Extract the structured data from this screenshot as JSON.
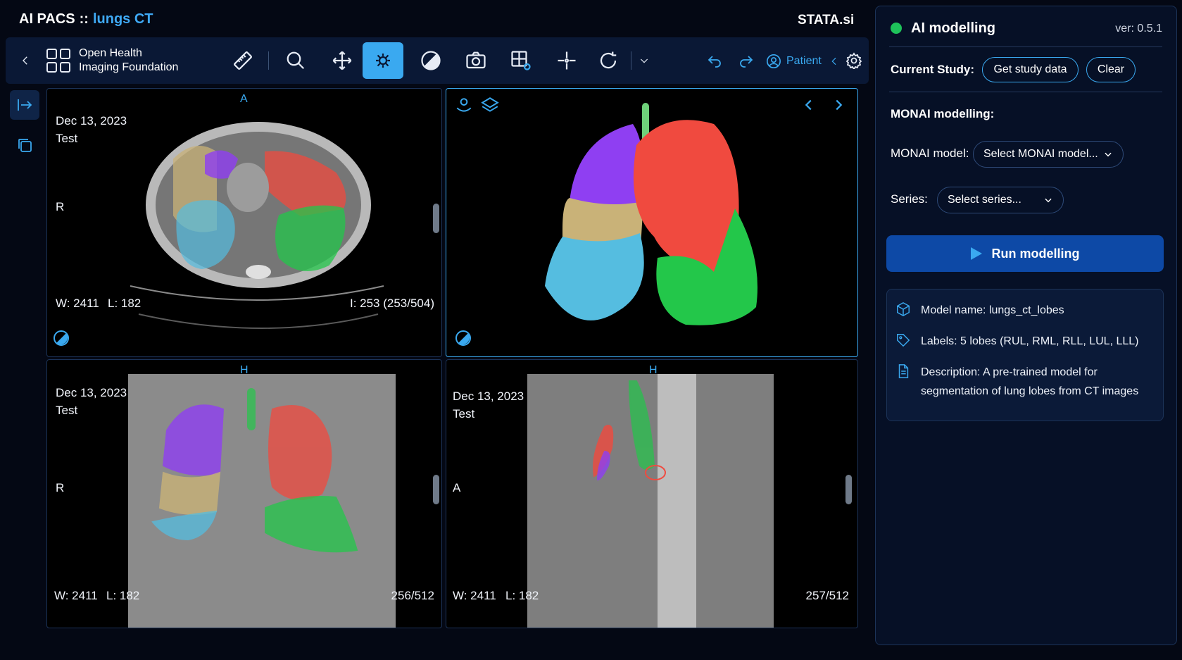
{
  "header": {
    "app_name": "AI PACS",
    "separator": "::",
    "study_name": "lungs CT",
    "brand": "STATA.si"
  },
  "toolbar": {
    "logo_line1": "Open Health",
    "logo_line2": "Imaging Foundation",
    "tools": [
      "back-chevron-icon",
      "ruler-icon",
      "magnify-icon",
      "pan-icon",
      "segmentation-icon",
      "contrast-icon",
      "camera-icon",
      "layout-icon",
      "crosshair-icon",
      "rotate-icon",
      "more-chevron-icon",
      "undo-icon",
      "redo-icon",
      "settings-icon"
    ],
    "patient_label": "Patient",
    "active_tool": "segmentation-icon",
    "accent": "#3aa9f0"
  },
  "viewports": {
    "axial": {
      "orientation_top": "A",
      "date": "Dec 13, 2023",
      "desc": "Test",
      "orientation_left": "R",
      "window": "W: 2411",
      "level": "L: 182",
      "instance": "I: 253 (253/504)"
    },
    "volume": {},
    "coronal": {
      "orientation_top": "H",
      "date": "Dec 13, 2023",
      "desc": "Test",
      "orientation_left": "R",
      "window": "W: 2411",
      "level": "L: 182",
      "instance": "256/512"
    },
    "sagittal": {
      "orientation_top": "H",
      "date": "Dec 13, 2023",
      "desc": "Test",
      "orientation_left": "A",
      "window": "W: 2411",
      "level": "L: 182",
      "instance": "257/512"
    }
  },
  "panel": {
    "title": "AI modelling",
    "version": "ver: 0.5.1",
    "status_color": "#1ec25a",
    "current_study_label": "Current Study:",
    "get_study_button": "Get study data",
    "clear_button": "Clear",
    "monai_section": "MONAI modelling:",
    "monai_model_label": "MONAI model:",
    "monai_model_placeholder": "Select MONAI model...",
    "series_label": "Series:",
    "series_placeholder": "Select series...",
    "run_button": "Run modelling",
    "model_name": "Model name: lungs_ct_lobes",
    "labels": "Labels: 5 lobes (RUL, RML, RLL, LUL, LLL)",
    "description_line1": "Description: A pre-trained model for",
    "description_line2": "segmentation of lung lobes from CT images"
  },
  "lobe_colors": {
    "RUL": "#8f3ff2",
    "RML": "#c9b278",
    "RLL": "#55bde0",
    "LUL": "#f04a3f",
    "LLL": "#23c74a"
  }
}
